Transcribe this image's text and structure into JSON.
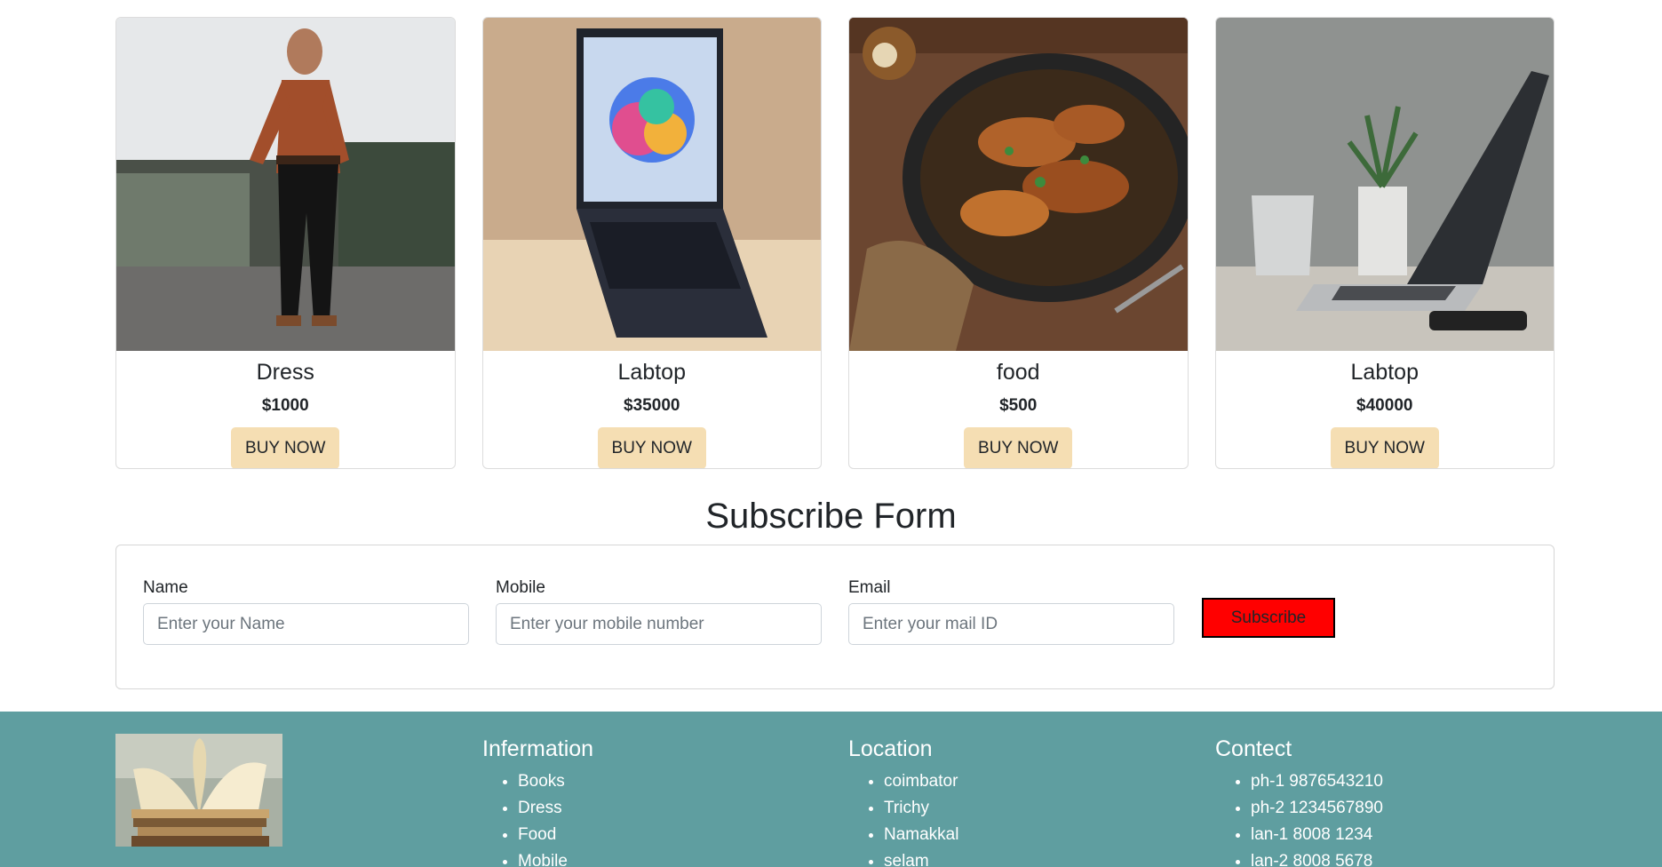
{
  "products": [
    {
      "name": "Dress",
      "price": "$1000",
      "button": "BUY NOW",
      "image": "man-in-rust-shirt-photo"
    },
    {
      "name": "Labtop",
      "price": "$35000",
      "button": "BUY NOW",
      "image": "dark-laptop-photo"
    },
    {
      "name": "food",
      "price": "$500",
      "button": "BUY NOW",
      "image": "chicken-dish-photo"
    },
    {
      "name": "Labtop",
      "price": "$40000",
      "button": "BUY NOW",
      "image": "laptop-on-desk-photo"
    }
  ],
  "subscribe": {
    "title": "Subscribe Form",
    "name_label": "Name",
    "name_placeholder": "Enter your Name",
    "mobile_label": "Mobile",
    "mobile_placeholder": "Enter your mobile number",
    "email_label": "Email",
    "email_placeholder": "Enter your mail ID",
    "button": "Subscribe"
  },
  "footer": {
    "logo": "open-book-photo",
    "information": {
      "title": "Infermation",
      "items": [
        "Books",
        "Dress",
        "Food",
        "Mobile"
      ]
    },
    "location": {
      "title": "Location",
      "items": [
        "coimbator",
        "Trichy",
        "Namakkal",
        "selam"
      ]
    },
    "contact": {
      "title": "Contect",
      "items": [
        "ph-1 9876543210",
        "ph-2 1234567890",
        "lan-1 8008 1234",
        "lan-2 8008 5678"
      ]
    }
  },
  "colors": {
    "buy_button": "#f5deb3",
    "subscribe_button": "#ff0000",
    "footer_bg": "#5f9ea0"
  }
}
